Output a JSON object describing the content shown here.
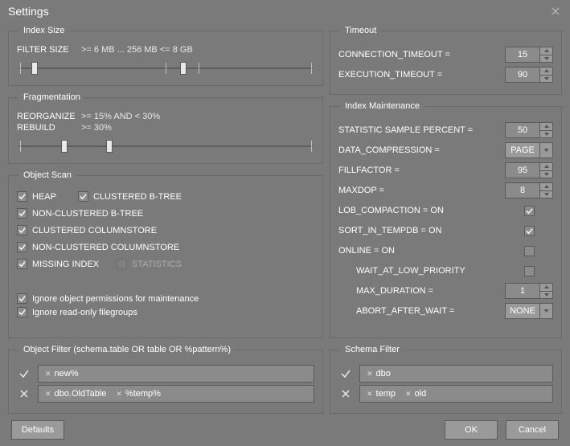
{
  "window": {
    "title": "Settings"
  },
  "index_size": {
    "legend": "Index Size",
    "label": "FILTER SIZE",
    "value": ">= 6 MB ... 256 MB <= 8 GB"
  },
  "fragmentation": {
    "legend": "Fragmentation",
    "reorganize_label": "REORGANIZE",
    "reorganize_value": ">= 15% AND < 30%",
    "rebuild_label": "REBUILD",
    "rebuild_value": ">= 30%"
  },
  "object_scan": {
    "legend": "Object Scan",
    "items": [
      {
        "label": "HEAP",
        "checked": true
      },
      {
        "label": "CLUSTERED B-TREE",
        "checked": true
      },
      {
        "label": "NON-CLUSTERED B-TREE",
        "checked": true
      },
      {
        "label": "CLUSTERED COLUMNSTORE",
        "checked": true
      },
      {
        "label": "NON-CLUSTERED COLUMNSTORE",
        "checked": true
      },
      {
        "label": "MISSING INDEX",
        "checked": true
      },
      {
        "label": "STATISTICS",
        "checked": false,
        "disabled": true
      }
    ],
    "ignore_perm_label": "Ignore object permissions for maintenance",
    "ignore_perm_checked": true,
    "ignore_ro_label": "Ignore read-only filegroups",
    "ignore_ro_checked": true
  },
  "timeout": {
    "legend": "Timeout",
    "connection_label": "CONNECTION_TIMEOUT =",
    "connection_value": "15",
    "execution_label": "EXECUTION_TIMEOUT =",
    "execution_value": "90"
  },
  "maint": {
    "legend": "Index Maintenance",
    "stat_sample_label": "STATISTIC SAMPLE PERCENT =",
    "stat_sample_value": "50",
    "data_comp_label": "DATA_COMPRESSION =",
    "data_comp_value": "PAGE",
    "fillfactor_label": "FILLFACTOR =",
    "fillfactor_value": "95",
    "maxdop_label": "MAXDOP =",
    "maxdop_value": "8",
    "lob_label": "LOB_COMPACTION = ON",
    "lob_checked": true,
    "sort_label": "SORT_IN_TEMPDB = ON",
    "sort_checked": true,
    "online_label": "ONLINE = ON",
    "online_checked": false,
    "wait_label": "WAIT_AT_LOW_PRIORITY",
    "wait_checked": false,
    "maxdur_label": "MAX_DURATION =",
    "maxdur_value": "1",
    "abort_label": "ABORT_AFTER_WAIT =",
    "abort_value": "NONE"
  },
  "obj_filter": {
    "legend": "Object Filter (schema.table OR table OR %pattern%)",
    "include": [
      "new%"
    ],
    "exclude": [
      "dbo.OldTable",
      "%temp%"
    ]
  },
  "schema_filter": {
    "legend": "Schema Filter",
    "include": [
      "dbo"
    ],
    "exclude": [
      "temp",
      "old"
    ]
  },
  "buttons": {
    "defaults": "Defaults",
    "ok": "OK",
    "cancel": "Cancel"
  }
}
